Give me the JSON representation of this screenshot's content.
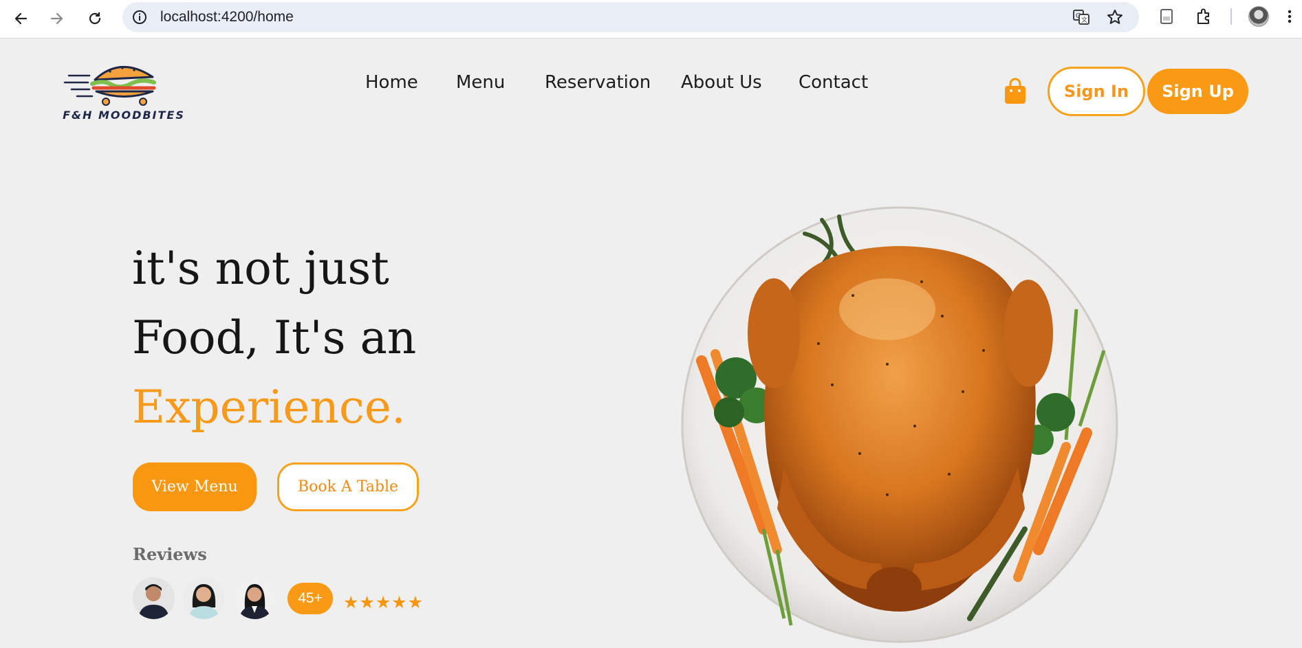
{
  "browser": {
    "url": "localhost:4200/home",
    "icons": [
      "back-icon",
      "forward-icon",
      "reload-icon",
      "site-info-icon",
      "translate-icon",
      "bookmark-star-icon",
      "reading-list-icon",
      "extensions-icon",
      "profile-avatar",
      "more-menu-icon"
    ]
  },
  "brand": {
    "name": "F&H MOODBITES",
    "accent": "#f99810"
  },
  "nav": {
    "items": [
      "Home",
      "Menu",
      "Reservation",
      "About Us",
      "Contact"
    ]
  },
  "auth": {
    "sign_in": "Sign In",
    "sign_up": "Sign Up"
  },
  "hero": {
    "line1": "it's not just",
    "line2": "Food, It's an",
    "line3": "Experience.",
    "view_menu": "View Menu",
    "book_table": "Book A Table"
  },
  "reviews": {
    "label": "Reviews",
    "count_badge": "45+",
    "stars": "★★★★★",
    "rating": 5
  }
}
